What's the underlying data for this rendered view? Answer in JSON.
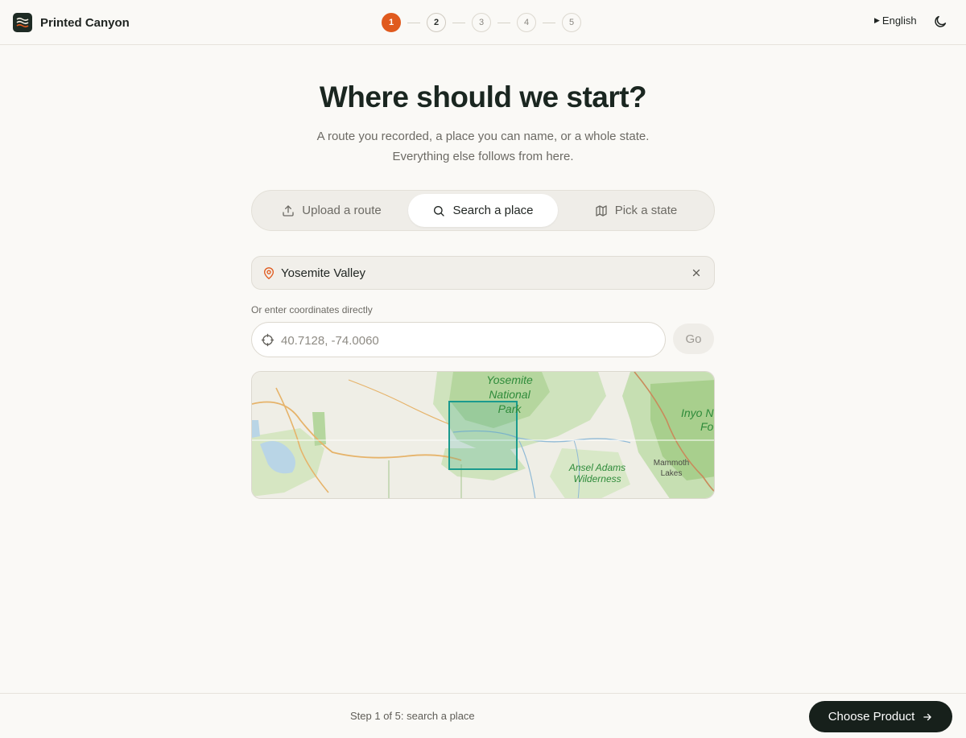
{
  "app": {
    "name": "Printed Canyon"
  },
  "header": {
    "steps": [
      "1",
      "2",
      "3",
      "4",
      "5"
    ],
    "current_step": 1,
    "language": "English"
  },
  "hero": {
    "title": "Where should we start?",
    "subtitle_line1": "A route you recorded, a place you can name, or a whole state.",
    "subtitle_line2": "Everything else follows from here."
  },
  "tabs": [
    {
      "label": "Upload a route",
      "icon": "upload-icon",
      "active": false
    },
    {
      "label": "Search a place",
      "icon": "search-icon",
      "active": true
    },
    {
      "label": "Pick a state",
      "icon": "map-icon",
      "active": false
    }
  ],
  "place_search": {
    "value": "Yosemite Valley",
    "icon": "map-pin-icon"
  },
  "coordinates": {
    "label": "Or enter coordinates directly",
    "placeholder": "40.7128, -74.0060",
    "value": "",
    "go_label": "Go"
  },
  "map": {
    "labels": {
      "park": [
        "Yosemite",
        "National",
        "Park"
      ],
      "wilderness": [
        "Ansel Adams",
        "Wilderness"
      ],
      "town": [
        "Mammoth",
        "Lakes"
      ],
      "forest": [
        "Inyo N",
        "Fo"
      ]
    }
  },
  "footer": {
    "status": "Step 1 of 5: search a place",
    "cta_label": "Choose Product"
  },
  "colors": {
    "accent": "#e05a1e",
    "primary_dark": "#17201b",
    "selection": "#1a9a8e",
    "background": "#faf9f6"
  }
}
